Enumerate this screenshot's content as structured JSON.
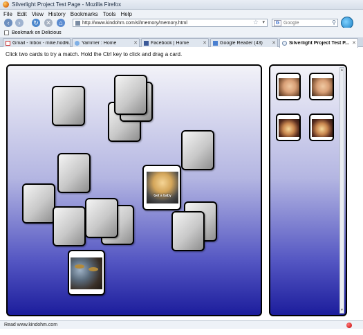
{
  "window": {
    "title": "Silverlight Project Test Page - Mozilla Firefox"
  },
  "menu": [
    "File",
    "Edit",
    "View",
    "History",
    "Bookmarks",
    "Tools",
    "Help"
  ],
  "nav": {
    "url": "http://www.kindohm.com/sl/memory/memory.html",
    "search_placeholder": "Google"
  },
  "bookmarks": {
    "items": [
      "Bookmark on Delicious"
    ]
  },
  "tabs": [
    {
      "label": "Gmail - Inbox - mike.hodni...",
      "icon": "gmail-icon",
      "active": false
    },
    {
      "label": "Yammer : Home",
      "icon": "yammer-icon",
      "active": false
    },
    {
      "label": "Facebook | Home",
      "icon": "facebook-icon",
      "active": false
    },
    {
      "label": "Google Reader (43)",
      "icon": "google-reader-icon",
      "active": false
    },
    {
      "label": "Silverlight Project Test P...",
      "icon": "page-icon",
      "active": true
    }
  ],
  "page": {
    "instruction": "Click two cards to try a match. Hold the Ctrl key to click and drag a card.",
    "revealed_card_caption": "Get a baby"
  },
  "status": {
    "text": "Read www.kindohm.com"
  },
  "colors": {
    "board_top": "#f2f2f8",
    "board_bottom": "#1c1d9c",
    "card_border": "#000000"
  }
}
